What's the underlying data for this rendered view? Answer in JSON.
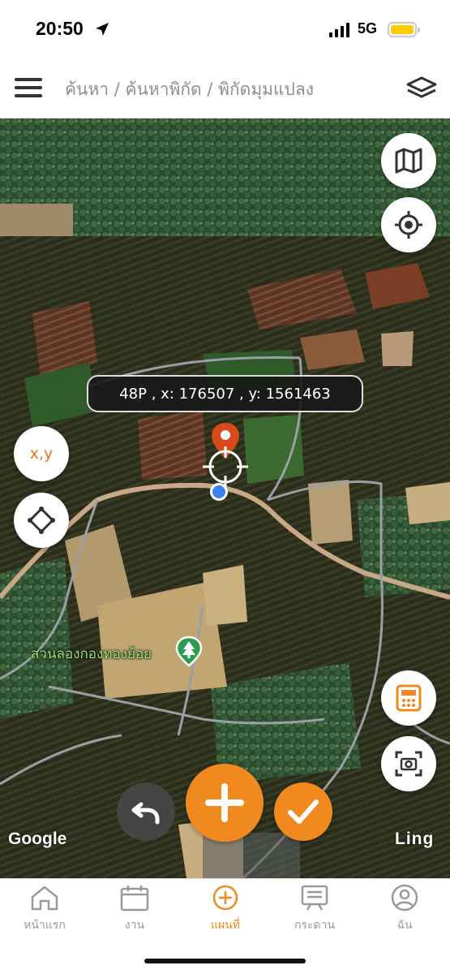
{
  "status_bar": {
    "time": "20:50",
    "network": "5G",
    "battery_color": "#ffcc00",
    "icons": [
      "location-arrow-icon",
      "signal-bars-icon",
      "battery-icon"
    ]
  },
  "header": {
    "menu_icon": "hamburger-menu-icon",
    "breadcrumb": "ค้นหา / ค้นหาพิกัด / พิกัดมุมแปลง",
    "layers_icon": "layers-icon"
  },
  "map": {
    "type": "satellite",
    "coordinate_readout": "48P , x: 176507 , y: 1561463",
    "place_label": "สวนลองกองทองย้อย",
    "place_icon": "tree-pin-icon",
    "map_provider": "Google",
    "brand": "Ling",
    "controls": {
      "map_type_icon": "map-icon",
      "my_location_icon": "crosshair-location-icon",
      "xy_button_label": "x,y",
      "polygon_icon": "diamond-polygon-icon",
      "calculator_icon": "calculator-icon",
      "screenshot_icon": "camera-frame-icon",
      "undo_icon": "undo-arrow-icon",
      "add_icon": "plus-icon",
      "confirm_icon": "checkmark-icon"
    }
  },
  "colors": {
    "accent": "#f08a1e",
    "pin": "#d84a1b",
    "location_dot": "#3b82f6",
    "inactive_tab": "#9a9a9a"
  },
  "tabs": [
    {
      "label": "หน้าแรก",
      "icon": "home-icon",
      "active": false
    },
    {
      "label": "งาน",
      "icon": "calendar-icon",
      "active": false
    },
    {
      "label": "แผนที่",
      "icon": "add-circle-icon",
      "active": true
    },
    {
      "label": "กระดาน",
      "icon": "board-icon",
      "active": false
    },
    {
      "label": "ฉัน",
      "icon": "user-icon",
      "active": false
    }
  ]
}
